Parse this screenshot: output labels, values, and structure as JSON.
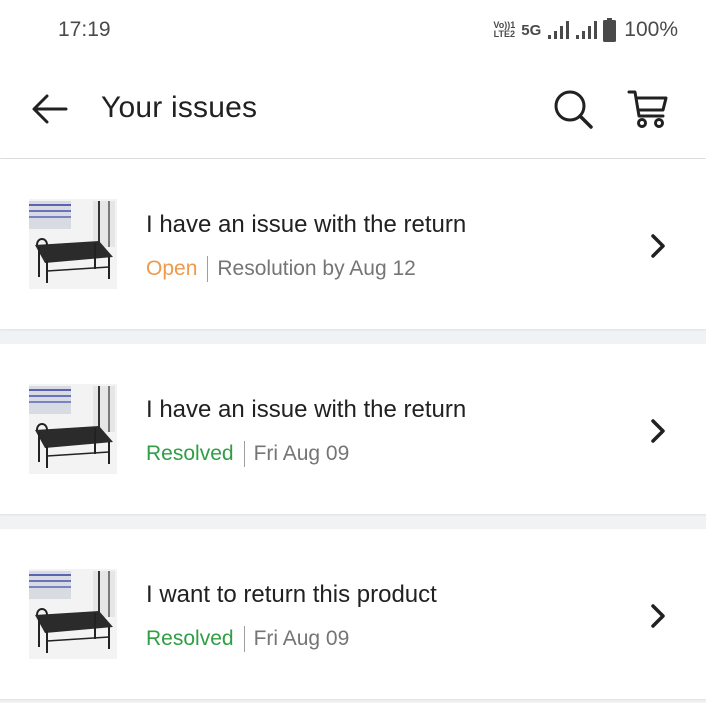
{
  "status_bar": {
    "time": "17:19",
    "volte_top": "Vo))1",
    "volte_bottom": "LTE2",
    "network": "5G",
    "battery": "100%"
  },
  "header": {
    "title": "Your issues",
    "back_icon": "arrow-left-icon",
    "search_icon": "search-icon",
    "cart_icon": "cart-icon"
  },
  "issues": [
    {
      "title": "I have an issue with the return",
      "status": "Open",
      "detail": "Resolution by Aug 12",
      "status_color": "#ef9a4a"
    },
    {
      "title": "I have an issue with the return",
      "status": "Resolved",
      "detail": "Fri Aug 09",
      "status_color": "#2f9e44"
    },
    {
      "title": "I want to return this product",
      "status": "Resolved",
      "detail": "Fri Aug 09",
      "status_color": "#2f9e44"
    }
  ]
}
